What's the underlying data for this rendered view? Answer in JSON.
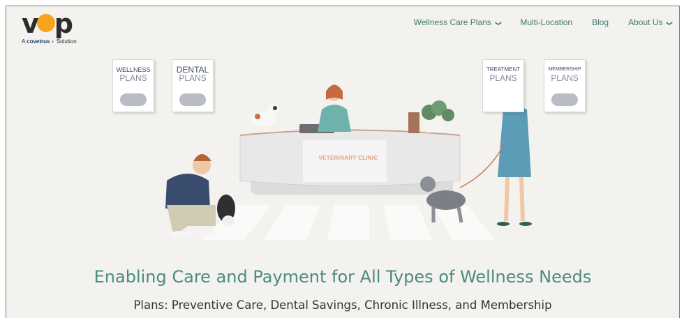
{
  "logo": {
    "mark_left": "v",
    "mark_right": "p",
    "tagline_prefix": "A",
    "tagline_brand": "covetrus",
    "tagline_suffix": "Solution"
  },
  "nav": {
    "items": [
      {
        "label": "Wellness Care Plans",
        "has_dropdown": true
      },
      {
        "label": "Multi-Location",
        "has_dropdown": false
      },
      {
        "label": "Blog",
        "has_dropdown": false
      },
      {
        "label": "About Us",
        "has_dropdown": true
      }
    ]
  },
  "hero": {
    "signs": [
      {
        "line1": "WELLNESS",
        "line2": "PLANS"
      },
      {
        "line1": "DENTAL",
        "line2": "PLANS"
      },
      {
        "line1": "TREATMENT",
        "line2": "PLANS"
      },
      {
        "line1": "MEMBERSHIP",
        "line2": "PLANS"
      }
    ],
    "desk_label": "VETERINARY CLINIC"
  },
  "headline": "Enabling Care and Payment for All Types of Wellness Needs",
  "subheadline": "Plans: Preventive Care, Dental Savings, Chronic Illness, and Membership",
  "colors": {
    "background": "#f3f2ef",
    "accent_green": "#4d8a80",
    "logo_orange": "#f4a51c",
    "desk_label": "#e2a07e"
  }
}
